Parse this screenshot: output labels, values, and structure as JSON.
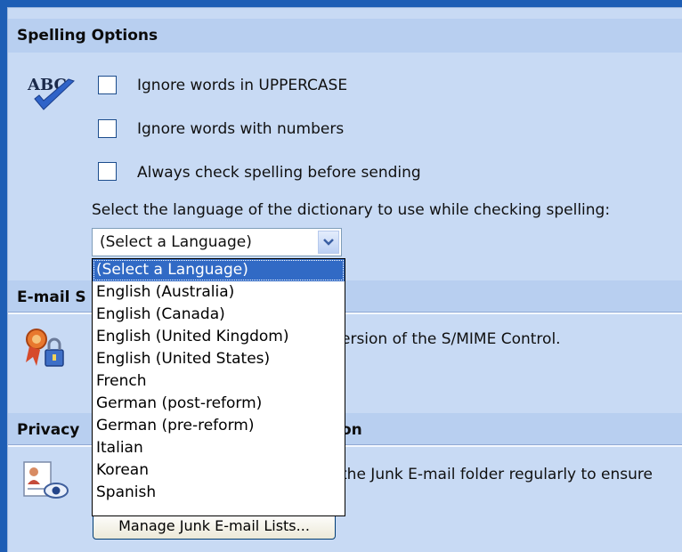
{
  "spelling": {
    "header": "Spelling Options",
    "options": [
      "Ignore words in UPPERCASE",
      "Ignore words with numbers",
      "Always check spelling before sending"
    ],
    "language_prompt": "Select the language of the dictionary to use while checking spelling:",
    "language_selected": "(Select a Language)",
    "language_options": [
      "(Select a Language)",
      "English (Australia)",
      "English (Canada)",
      "English (United Kingdom)",
      "English (United States)",
      "French",
      "German (post-reform)",
      "German (pre-reform)",
      "Italian",
      "Korean",
      "Spanish"
    ],
    "icon": "abc-checkmark-icon",
    "icon_text": "ABC"
  },
  "email_security": {
    "header_visible": "E-mail S",
    "text_visible": "ersion of the S/MIME Control.",
    "icon": "certificate-lock-icon"
  },
  "privacy": {
    "header_left": "Privacy",
    "header_right": "on",
    "text_visible": "the Junk E-mail folder regularly to ensure",
    "icon": "user-document-eye-icon",
    "button_label": "Manage Junk E-mail Lists..."
  },
  "colors": {
    "background": "#1e5eb5",
    "panel": "#c8daf4",
    "selection": "#316ac5"
  }
}
